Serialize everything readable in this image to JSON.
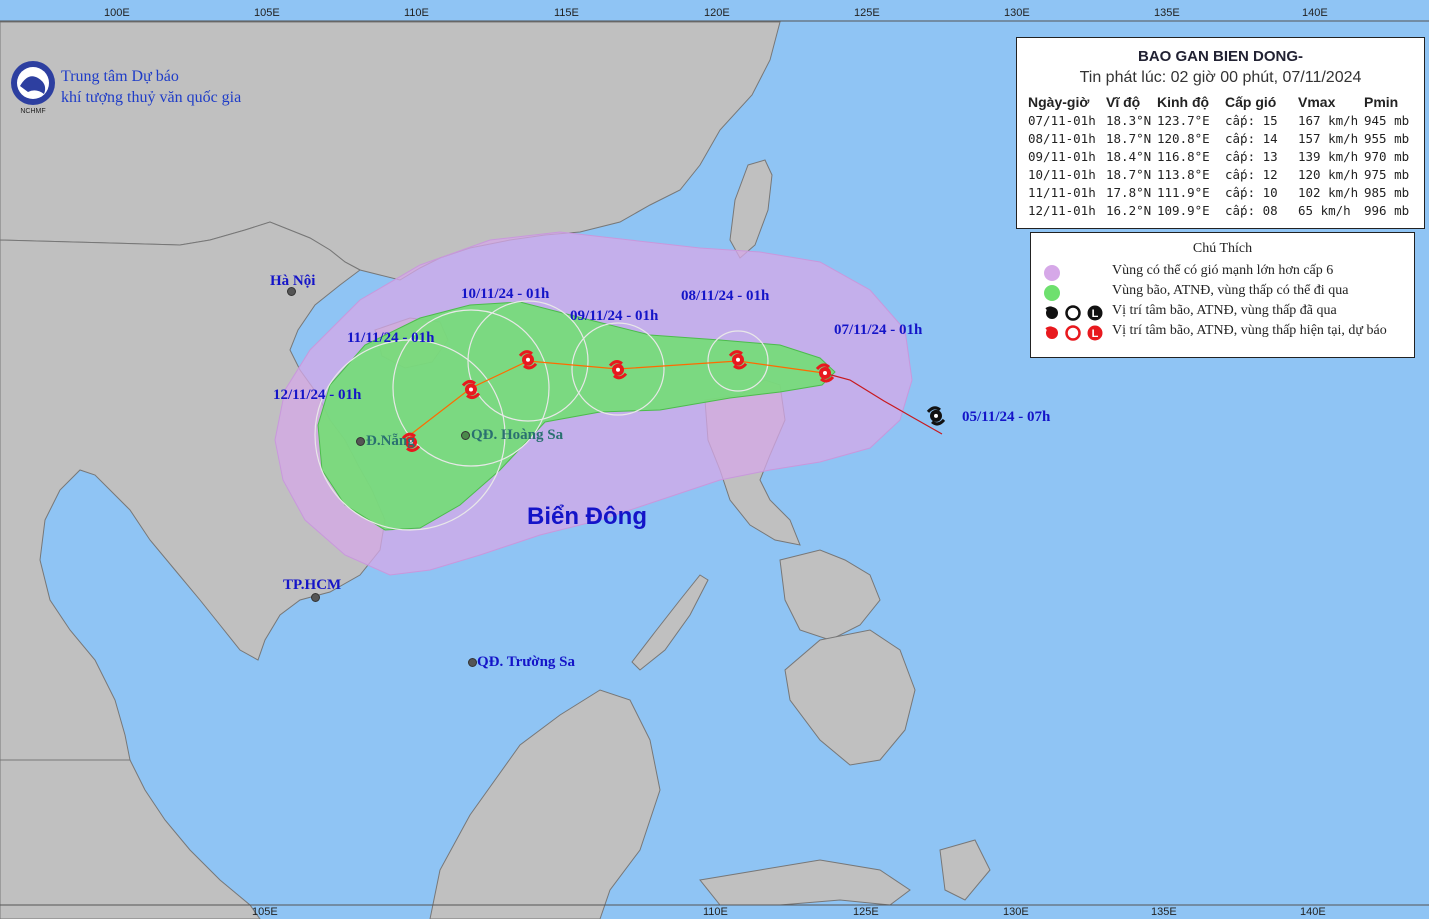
{
  "header": {
    "agency_line1": "Trung tâm Dự báo",
    "agency_line2": "khí tượng thuỷ văn quốc gia",
    "logo_text": "NCHMF"
  },
  "info_box": {
    "title": "BAO GAN BIEN DONG-",
    "issued": "Tin phát lúc: 02 giờ 00 phút, 07/11/2024",
    "columns": [
      "Ngày-giờ",
      "Vĩ độ",
      "Kinh độ",
      "Cấp gió",
      "Vmax",
      "Pmin"
    ],
    "rows": [
      [
        "07/11-01h",
        "18.3°N",
        "123.7°E",
        "cấp: 15",
        "167 km/h",
        "945 mb"
      ],
      [
        "08/11-01h",
        "18.7°N",
        "120.8°E",
        "cấp: 14",
        "157 km/h",
        "955 mb"
      ],
      [
        "09/11-01h",
        "18.4°N",
        "116.8°E",
        "cấp: 13",
        "139 km/h",
        "970 mb"
      ],
      [
        "10/11-01h",
        "18.7°N",
        "113.8°E",
        "cấp: 12",
        "120 km/h",
        "975 mb"
      ],
      [
        "11/11-01h",
        "17.8°N",
        "111.9°E",
        "cấp: 10",
        "102 km/h",
        "985 mb"
      ],
      [
        "12/11-01h",
        "16.2°N",
        "109.9°E",
        "cấp: 08",
        "65 km/h",
        "996 mb"
      ]
    ]
  },
  "legend": {
    "title": "Chú Thích",
    "items": [
      {
        "label": "Vùng có thể có gió mạnh lớn hơn cấp 6",
        "color": "#d6a8e8"
      },
      {
        "label": "Vùng bão, ATNĐ, vùng thấp có thể đi qua",
        "color": "#6ee06e"
      },
      {
        "label": "Vị trí tâm bão, ATNĐ, vùng thấp đã qua",
        "color": "#111111"
      },
      {
        "label": "Vị trí tâm bão, ATNĐ, vùng thấp hiện tại, dự báo",
        "color": "#e8191e"
      }
    ]
  },
  "map_labels": {
    "sea_name": "Biển Đông",
    "ha_noi": "Hà Nội",
    "da_nang": "Đ.Nẵng",
    "hoang_sa": "QĐ. Hoàng Sa",
    "truong_sa": "QĐ. Trường Sa",
    "hcm": "TP.HCM"
  },
  "track": {
    "past": [
      {
        "label": "05/11/24 - 07h",
        "lon": 127.4,
        "lat": 17.0
      }
    ],
    "forecast": [
      {
        "label": "07/11/24 - 01h",
        "lon": 123.7,
        "lat": 18.3
      },
      {
        "label": "08/11/24 - 01h",
        "lon": 120.8,
        "lat": 18.7
      },
      {
        "label": "09/11/24 - 01h",
        "lon": 116.8,
        "lat": 18.4
      },
      {
        "label": "10/11/24 - 01h",
        "lon": 113.8,
        "lat": 18.7
      },
      {
        "label": "11/11/24 - 01h",
        "lon": 111.9,
        "lat": 17.8
      },
      {
        "label": "12/11/24 - 01h",
        "lon": 109.9,
        "lat": 16.2
      }
    ],
    "past_color": "#111111",
    "forecast_color": "#e8191e"
  },
  "axis": {
    "top_ticks": [
      "100E",
      "105E",
      "110E",
      "115E",
      "120E",
      "125E",
      "130E",
      "135E",
      "140E"
    ],
    "bottom_ticks": [
      "105E",
      "110E",
      "125E",
      "130E",
      "135E",
      "140E"
    ]
  },
  "colors": {
    "sea": "#8fc4f4",
    "land": "#c0c0c0",
    "wind_zone": "#d6a8e8",
    "storm_zone": "#6ee06e"
  }
}
